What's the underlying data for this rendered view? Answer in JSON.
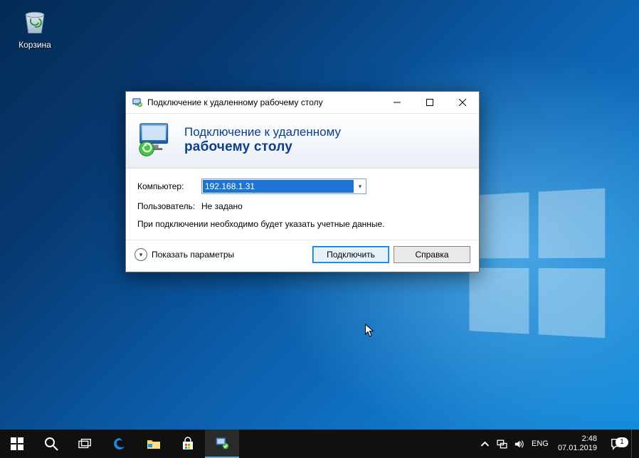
{
  "desktop": {
    "recycle_bin_label": "Корзина"
  },
  "window": {
    "title": "Подключение к удаленному рабочему столу",
    "header_line1": "Подключение к удаленному",
    "header_line2": "рабочему столу",
    "computer_label": "Компьютер:",
    "computer_value": "192.168.1.31",
    "user_label": "Пользователь:",
    "user_value": "Не задано",
    "hint": "При подключении необходимо будет указать учетные данные.",
    "show_options": "Показать параметры",
    "connect": "Подключить",
    "help": "Справка"
  },
  "taskbar": {
    "lang": "ENG",
    "time": "2:48",
    "date": "07.01.2019",
    "notif_count": "1"
  }
}
